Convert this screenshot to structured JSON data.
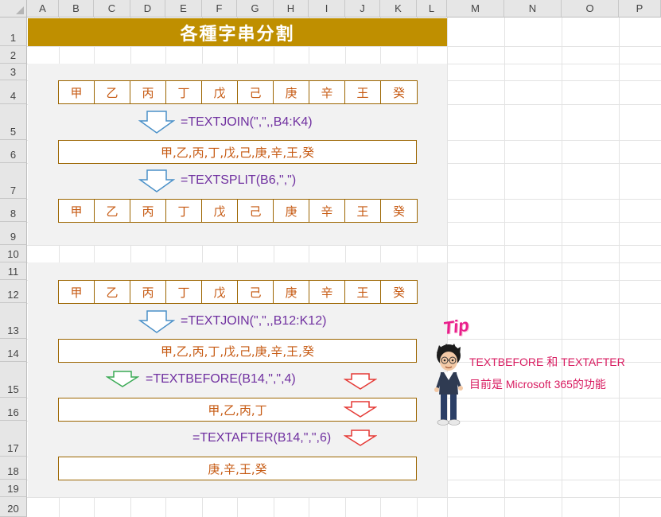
{
  "columns": [
    "A",
    "B",
    "C",
    "D",
    "E",
    "F",
    "G",
    "H",
    "I",
    "J",
    "K",
    "L",
    "M",
    "N",
    "O",
    "P"
  ],
  "rows": [
    "1",
    "2",
    "3",
    "4",
    "5",
    "6",
    "7",
    "8",
    "9",
    "10",
    "11",
    "12",
    "13",
    "14",
    "15",
    "16",
    "17",
    "18",
    "19",
    "20"
  ],
  "title": "各種字串分割",
  "stems": [
    "甲",
    "乙",
    "丙",
    "丁",
    "戊",
    "己",
    "庚",
    "辛",
    "王",
    "癸"
  ],
  "section1": {
    "formula1": "=TEXTJOIN(\",\",,B4:K4)",
    "joined": "甲,乙,丙,丁,戊,己,庚,辛,王,癸",
    "formula2": "=TEXTSPLIT(B6,\",\")"
  },
  "section2": {
    "formula1": "=TEXTJOIN(\",\",,B12:K12)",
    "joined": "甲,乙,丙,丁,戊,己,庚,辛,王,癸",
    "formula_before": "=TEXTBEFORE(B14,\",\",4)",
    "before_result": "甲,乙,丙,丁",
    "formula_after": "=TEXTAFTER(B14,\",\",6)",
    "after_result": "庚,辛,王,癸"
  },
  "tip": {
    "badge": "Tip",
    "line1": "TEXTBEFORE 和 TEXTAFTER",
    "line2": "目前是 Microsoft 365的功能"
  },
  "colors": {
    "title_bg": "#bf8f00",
    "cell_text": "#c65911",
    "formula_text": "#7030a0",
    "tip_text": "#d81b60",
    "arrow_blue": "#4a90c8",
    "arrow_green": "#3aaa55",
    "arrow_red": "#e53935"
  }
}
